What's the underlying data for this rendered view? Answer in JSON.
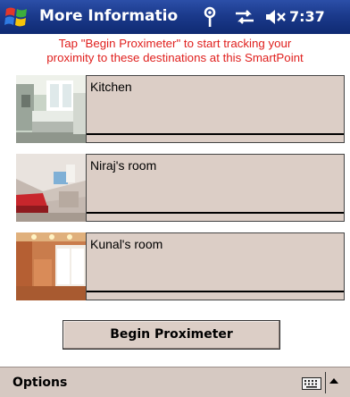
{
  "titlebar": {
    "title": "More Informatio",
    "time": "7:37",
    "icons": [
      "windows-start-icon",
      "antenna-icon",
      "sync-icon",
      "speaker-muted-icon"
    ]
  },
  "instruction": {
    "line1": "Tap \"Begin Proximeter\" to start tracking your",
    "line2": "proximity to these destinations at this SmartPoint"
  },
  "destinations": [
    {
      "label": "Kitchen"
    },
    {
      "label": "Niraj's room"
    },
    {
      "label": "Kunal's room"
    }
  ],
  "begin_button": {
    "label": "Begin Proximeter"
  },
  "menubar": {
    "options_label": "Options"
  },
  "colors": {
    "titlebar": "#1b3a8c",
    "instruction_text": "#e0201e",
    "panel": "#dccec6",
    "menubar": "#d6c9c2"
  }
}
